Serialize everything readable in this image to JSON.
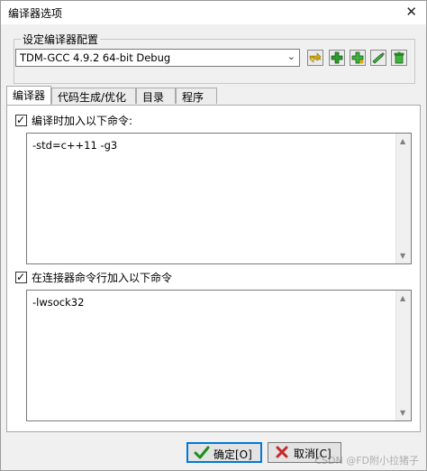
{
  "window": {
    "title": "编译器选项",
    "close_glyph": "✕"
  },
  "config_group": {
    "label": "设定编译器配置",
    "selected_profile": "TDM-GCC 4.9.2 64-bit Debug",
    "toolbar_icons": [
      "swap-arrows-icon",
      "add-icon",
      "add-copy-icon",
      "rename-icon",
      "delete-icon"
    ]
  },
  "tabs": [
    {
      "label": "编译器",
      "active": true
    },
    {
      "label": "代码生成/优化",
      "active": false
    },
    {
      "label": "目录",
      "active": false
    },
    {
      "label": "程序",
      "active": false
    }
  ],
  "compiler_section": {
    "checkbox_label": "编译时加入以下命令:",
    "checked": true,
    "command_text": "-std=c++11 -g3"
  },
  "linker_section": {
    "checkbox_label": "在连接器命令行加入以下命令",
    "checked": true,
    "command_text": "-lwsock32"
  },
  "buttons": {
    "ok_label": "确定[O]",
    "cancel_label": "取消[C]"
  },
  "watermark": "CSDN @FD附小拉猪子",
  "colors": {
    "accent": "#0078d7",
    "icon_green": "#2e9b2e",
    "ok_check": "#1a8f1a",
    "cancel_x": "#c62828"
  }
}
